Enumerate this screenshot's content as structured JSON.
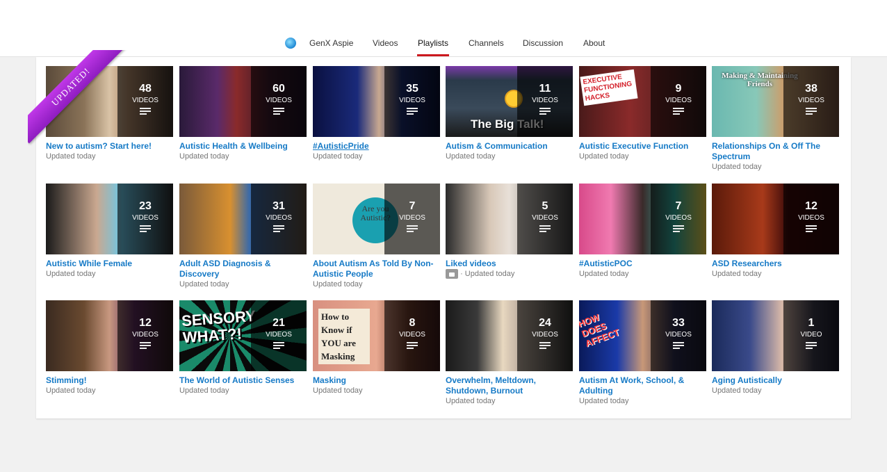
{
  "channel": {
    "name": "GenX Aspie",
    "avatar_icon": "globe-avatar"
  },
  "nav": {
    "videos": "Videos",
    "playlists": "Playlists",
    "channels": "Channels",
    "discussion": "Discussion",
    "about": "About"
  },
  "ribbon": {
    "text": "UPDATED!"
  },
  "colors": {
    "accent": "#cc181e",
    "link": "#167ac6",
    "ribbon": "#b02ee0"
  },
  "thumb_text": {
    "big_talk": "The Big Talk!",
    "exec_hacks": "EXECUTIVE FUNCTIONING HACKS",
    "making_friends": "Making & Maintaining Friends",
    "are_you": "Are you Autistic?",
    "sensory": "SENSORY WHAT?!",
    "masking_sign": "How to Know if YOU are Masking",
    "how_does": "HOW DOES AFFECT"
  },
  "playlists": [
    {
      "title": "New to autism? Start here!",
      "count": "48",
      "unit": "VIDEOS",
      "status": "Updated today"
    },
    {
      "title": "Autistic Health & Wellbeing",
      "count": "60",
      "unit": "VIDEOS",
      "status": "Updated today"
    },
    {
      "title": "#AutisticPride",
      "count": "35",
      "unit": "VIDEOS",
      "status": "Updated today"
    },
    {
      "title": "Autism & Communication",
      "count": "11",
      "unit": "VIDEOS",
      "status": "Updated today"
    },
    {
      "title": "Autistic Executive Function",
      "count": "9",
      "unit": "VIDEOS",
      "status": "Updated today"
    },
    {
      "title": "Relationships On & Off The Spectrum",
      "count": "38",
      "unit": "VIDEOS",
      "status": "Updated today"
    },
    {
      "title": "Autistic While Female",
      "count": "23",
      "unit": "VIDEOS",
      "status": "Updated today"
    },
    {
      "title": "Adult ASD Diagnosis & Discovery",
      "count": "31",
      "unit": "VIDEOS",
      "status": "Updated today"
    },
    {
      "title": "About Autism As Told By Non-Autistic People",
      "count": "7",
      "unit": "VIDEOS",
      "status": "Updated today"
    },
    {
      "title": "Liked videos",
      "count": "5",
      "unit": "VIDEOS",
      "status": "· Updated today"
    },
    {
      "title": "#AutisticPOC",
      "count": "7",
      "unit": "VIDEOS",
      "status": "Updated today"
    },
    {
      "title": "ASD Researchers",
      "count": "12",
      "unit": "VIDEOS",
      "status": "Updated today"
    },
    {
      "title": "Stimming!",
      "count": "12",
      "unit": "VIDEOS",
      "status": "Updated today"
    },
    {
      "title": "The World of Autistic Senses",
      "count": "21",
      "unit": "VIDEOS",
      "status": "Updated today"
    },
    {
      "title": "Masking",
      "count": "8",
      "unit": "VIDEOS",
      "status": "Updated today"
    },
    {
      "title": "Overwhelm, Meltdown, Shutdown, Burnout",
      "count": "24",
      "unit": "VIDEOS",
      "status": "Updated today"
    },
    {
      "title": "Autism At Work, School, & Adulting",
      "count": "33",
      "unit": "VIDEOS",
      "status": "Updated today"
    },
    {
      "title": "Aging Autistically",
      "count": "1",
      "unit": "VIDEO",
      "status": "Updated today"
    }
  ]
}
